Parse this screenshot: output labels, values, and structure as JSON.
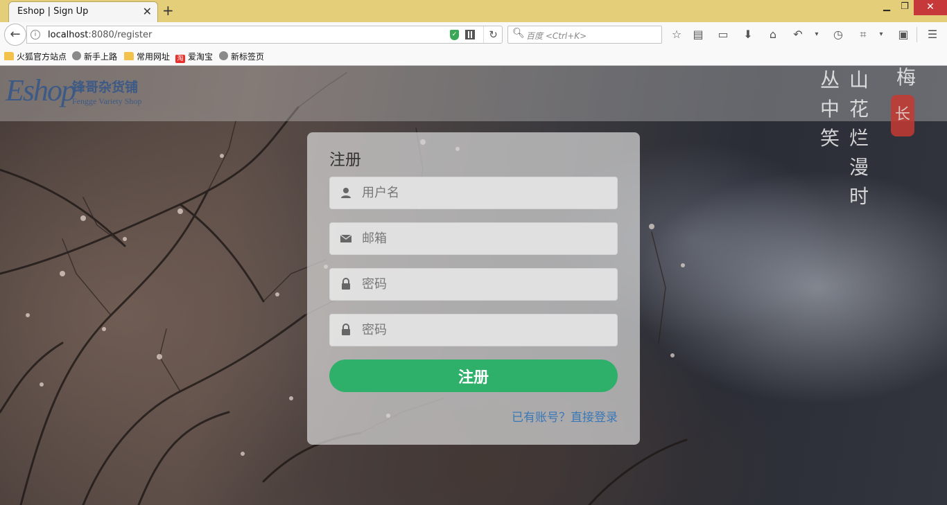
{
  "browser": {
    "tab_title": "Eshop | Sign Up",
    "tab_close": "✕",
    "new_tab": "+",
    "window_controls": {
      "minimize": "▁",
      "maximize": "❐",
      "close": "✕"
    },
    "url_host": "localhost",
    "url_rest": ":8080/register",
    "search_placeholder": "百度 <Ctrl+K>",
    "toolbar_icons": [
      "star-icon",
      "reading-list-icon",
      "window-icon",
      "download-icon",
      "home-icon",
      "undo-icon",
      "history-icon",
      "screenshot-icon",
      "reader-icon",
      "menu-icon"
    ],
    "bookmarks": [
      {
        "label": "火狐官方站点",
        "icon": "folder-icon"
      },
      {
        "label": "新手上路",
        "icon": "globe-icon"
      },
      {
        "label": "常用网址",
        "icon": "folder-icon"
      },
      {
        "label": "爱淘宝",
        "icon": "taobao-icon"
      },
      {
        "label": "新标签页",
        "icon": "globe-icon"
      }
    ]
  },
  "site": {
    "logo_mark": "Eshop",
    "logo_cn": "锋哥杂货铺",
    "logo_en": "Fengge Variety Shop",
    "background_poem": [
      "梅",
      "山花烂漫时",
      "丛中笑"
    ],
    "seal": "长"
  },
  "register": {
    "title": "注册",
    "fields": [
      {
        "name": "username",
        "placeholder": "用户名",
        "icon": "user-icon"
      },
      {
        "name": "email",
        "placeholder": "邮箱",
        "icon": "envelope-icon"
      },
      {
        "name": "password",
        "placeholder": "密码",
        "icon": "lock-icon"
      },
      {
        "name": "password-confirm",
        "placeholder": "密码",
        "icon": "lock-icon"
      }
    ],
    "submit_label": "注册",
    "login_link": "已有账号？直接登录"
  },
  "colors": {
    "tabbar": "#e4ce7a",
    "submit_button": "#2eb06a",
    "link": "#3a78b8",
    "logo": "#3d5a86"
  }
}
